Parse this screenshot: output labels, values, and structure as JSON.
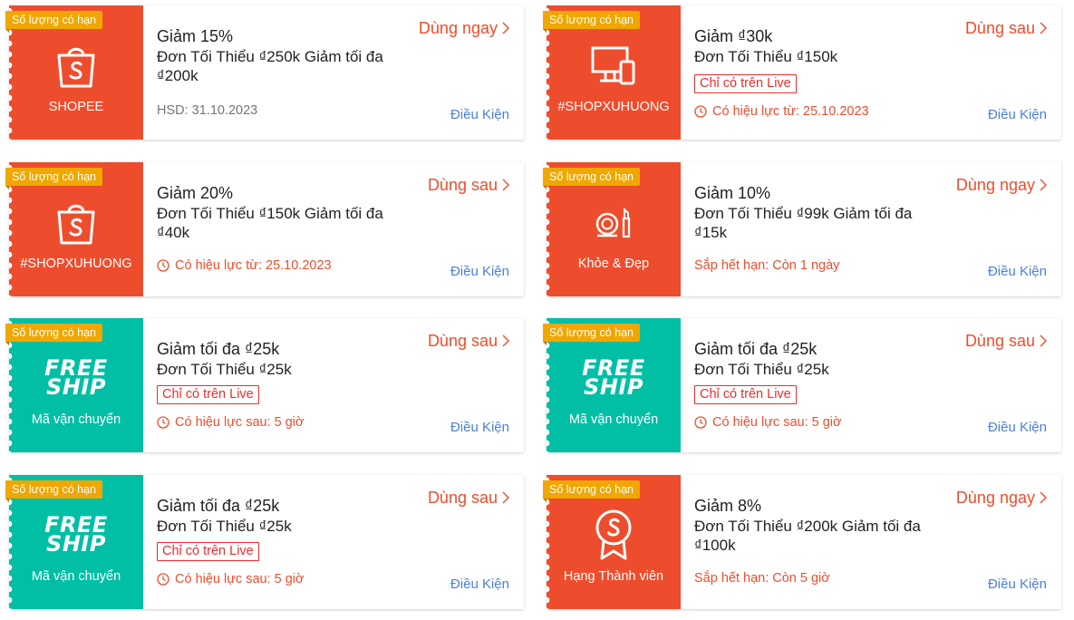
{
  "vouchers": [
    {
      "badge": "Số lượng có hạn",
      "left_label": "SHOPEE",
      "title": "Giảm 15%",
      "subtitle": "Đơn Tối Thiểu ₫250k Giảm tối đa ₫200k",
      "status": "HSD: 31.10.2023",
      "action": "Dùng ngay",
      "condition": "Điều Kiện"
    },
    {
      "badge": "Số lượng có hạn",
      "left_label": "#SHOPXUHUONG",
      "title": "Giảm ₫30k",
      "subtitle": "Đơn Tối Thiểu ₫150k",
      "live_tag": "Chỉ có trên Live",
      "status": "Có hiệu lực từ: 25.10.2023",
      "action": "Dùng sau",
      "condition": "Điều Kiện"
    },
    {
      "badge": "Số lượng có hạn",
      "left_label": "#SHOPXUHUONG",
      "title": "Giảm 20%",
      "subtitle": "Đơn Tối Thiểu ₫150k Giảm tối đa ₫40k",
      "status": "Có hiệu lực từ: 25.10.2023",
      "action": "Dùng sau",
      "condition": "Điều Kiện"
    },
    {
      "badge": "Số lượng có hạn",
      "left_label": "Khỏe & Đẹp",
      "title": "Giảm 10%",
      "subtitle": "Đơn Tối Thiểu ₫99k Giảm tối đa ₫15k",
      "status": "Sắp hết hạn: Còn 1 ngày",
      "action": "Dùng ngay",
      "condition": "Điều Kiện"
    },
    {
      "badge": "Số lượng có hạn",
      "free_top": "FREE",
      "free_bottom": "SHIP",
      "left_label": "Mã vận chuyển",
      "title": "Giảm tối đa ₫25k",
      "subtitle": "Đơn Tối Thiểu ₫25k",
      "live_tag": "Chỉ có trên Live",
      "status": "Có hiệu lực sau: 5 giờ",
      "action": "Dùng sau",
      "condition": "Điều Kiện"
    },
    {
      "badge": "Số lượng có hạn",
      "free_top": "FREE",
      "free_bottom": "SHIP",
      "left_label": "Mã vận chuyển",
      "title": "Giảm tối đa ₫25k",
      "subtitle": "Đơn Tối Thiểu ₫25k",
      "live_tag": "Chỉ có trên Live",
      "status": "Có hiệu lực sau: 5 giờ",
      "action": "Dùng sau",
      "condition": "Điều Kiện"
    },
    {
      "badge": "Số lượng có hạn",
      "free_top": "FREE",
      "free_bottom": "SHIP",
      "left_label": "Mã vận chuyển",
      "title": "Giảm tối đa ₫25k",
      "subtitle": "Đơn Tối Thiểu ₫25k",
      "live_tag": "Chỉ có trên Live",
      "status": "Có hiệu lực sau: 5 giờ",
      "action": "Dùng sau",
      "condition": "Điều Kiện"
    },
    {
      "badge": "Số lượng có hạn",
      "left_label": "Hạng Thành viên",
      "title": "Giảm 8%",
      "subtitle": "Đơn Tối Thiểu ₫200k Giảm tối đa ₫100k",
      "status": "Sắp hết hạn: Còn 5 giờ",
      "action": "Dùng ngay",
      "condition": "Điều Kiện"
    }
  ],
  "colors": {
    "shopee_orange": "#ee4d2d",
    "freeship_teal": "#00bfa5",
    "badge_yellow": "#f0a700",
    "link_blue": "#4a7fe0",
    "live_red": "#ee2c2c"
  },
  "icons": [
    "shopee-bag-icon",
    "devices-icon",
    "cosmetics-icon",
    "member-medal-icon",
    "clock-icon",
    "chevron-right-icon"
  ]
}
